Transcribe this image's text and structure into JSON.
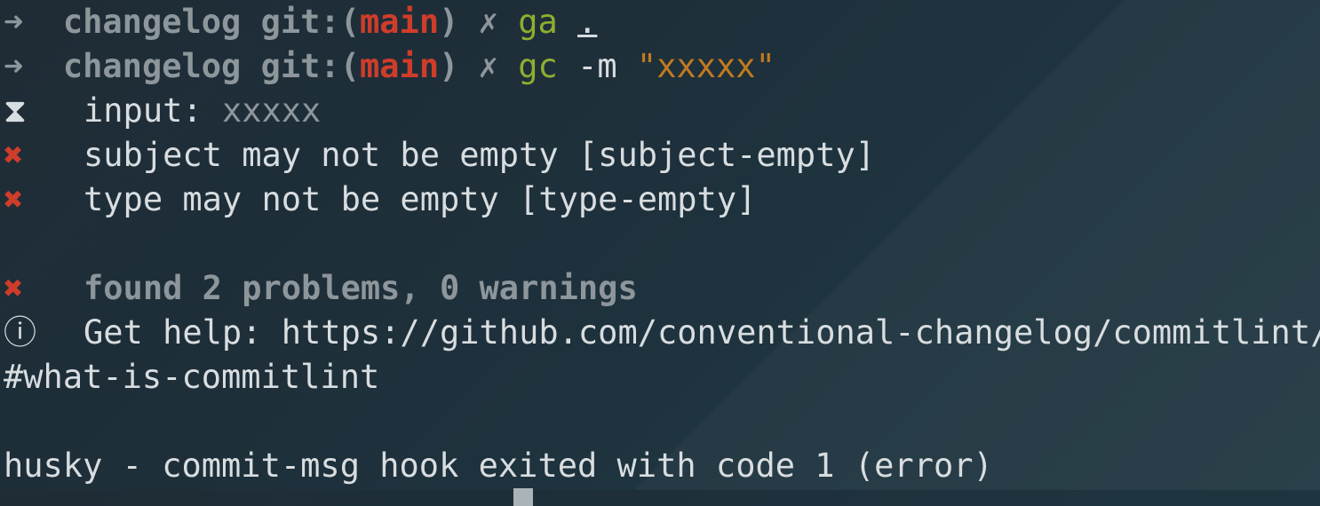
{
  "prompts": [
    {
      "arrow": "➜",
      "dir": "changelog",
      "git_prefix": "git:(",
      "branch": "main",
      "git_suffix": ")",
      "dirty": "✗",
      "cmd": "ga",
      "arg": "."
    },
    {
      "arrow": "➜",
      "dir": "changelog",
      "git_prefix": "git:(",
      "branch": "main",
      "git_suffix": ")",
      "dirty": "✗",
      "cmd": "gc",
      "flag": "-m",
      "arg": "\"xxxxx\""
    }
  ],
  "commitlint": {
    "input_icon": "⧗",
    "input_label": "input:",
    "input_value": "xxxxx",
    "errors": [
      {
        "icon": "✖",
        "text": "subject may not be empty [subject-empty]"
      },
      {
        "icon": "✖",
        "text": "type may not be empty [type-empty]"
      }
    ],
    "summary_icon": "✖",
    "summary": "found 2 problems, 0 warnings",
    "help_icon": "ⓘ",
    "help_text": "Get help: https://github.com/conventional-changelog/commitlint/",
    "help_text_wrap": "#what-is-commitlint"
  },
  "husky": "husky - commit-msg hook exited with code 1 (error)",
  "colors": {
    "accent_green": "#8fae2f",
    "error_red": "#cf3d2a",
    "string_orange": "#c27a1f",
    "background": "#1f2c36"
  }
}
